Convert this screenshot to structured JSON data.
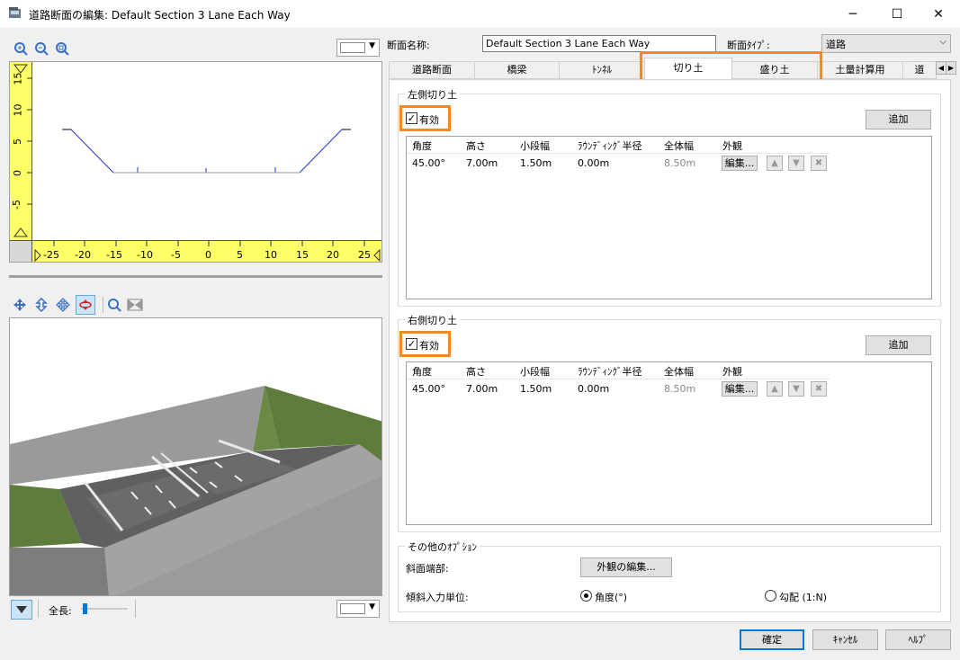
{
  "window": {
    "title": "道路断面の編集: Default Section 3 Lane Each Way",
    "minimize": "─",
    "maximize": "☐",
    "close": "✕"
  },
  "left": {
    "ruler_y_ticks": [
      "15",
      "10",
      "5",
      "0",
      "-5"
    ],
    "ruler_x_ticks": [
      "-25",
      "-20",
      "-15",
      "-10",
      "-5",
      "0",
      "5",
      "10",
      "15",
      "20",
      "25"
    ],
    "length_label": "全長:"
  },
  "form": {
    "section_name_label": "断面名称:",
    "section_name_value": "Default Section 3 Lane Each Way",
    "section_type_label": "断面ﾀｲﾌﾟ:",
    "section_type_value": "道路"
  },
  "tabs": [
    "道路断面",
    "橋梁",
    "ﾄﾝﾈﾙ",
    "切り土",
    "盛り土",
    "土量計算用",
    "道"
  ],
  "selected_tab": "切り土",
  "left_cut": {
    "title": "左側切り土",
    "enabled_label": "有効",
    "add_label": "追加",
    "columns": [
      "角度",
      "高さ",
      "小段幅",
      "ﾗｳﾝﾃﾞｨﾝｸﾞ半径",
      "全体幅",
      "外観"
    ],
    "row": {
      "angle": "45.00°",
      "height": "7.00m",
      "step": "1.50m",
      "radius": "0.00m",
      "width": "8.50m",
      "edit": "編集..."
    }
  },
  "right_cut": {
    "title": "右側切り土",
    "enabled_label": "有効",
    "add_label": "追加",
    "columns": [
      "角度",
      "高さ",
      "小段幅",
      "ﾗｳﾝﾃﾞｨﾝｸﾞ半径",
      "全体幅",
      "外観"
    ],
    "row": {
      "angle": "45.00°",
      "height": "7.00m",
      "step": "1.50m",
      "radius": "0.00m",
      "width": "8.50m",
      "edit": "編集..."
    }
  },
  "options": {
    "title": "その他のｵﾌﾟｼｮﾝ",
    "slope_end_label": "斜面端部:",
    "appearance_button": "外観の編集...",
    "slope_unit_label": "傾斜入力単位:",
    "radio_angle": "角度(°)",
    "radio_grade": "勾配 (1:N)"
  },
  "footer": {
    "ok": "確定",
    "cancel": "ｷｬﾝｾﾙ",
    "help": "ﾍﾙﾌﾟ"
  },
  "colors": {
    "highlight": "#f08a24",
    "accent": "#0078d7",
    "ruler": "#ffff66"
  }
}
